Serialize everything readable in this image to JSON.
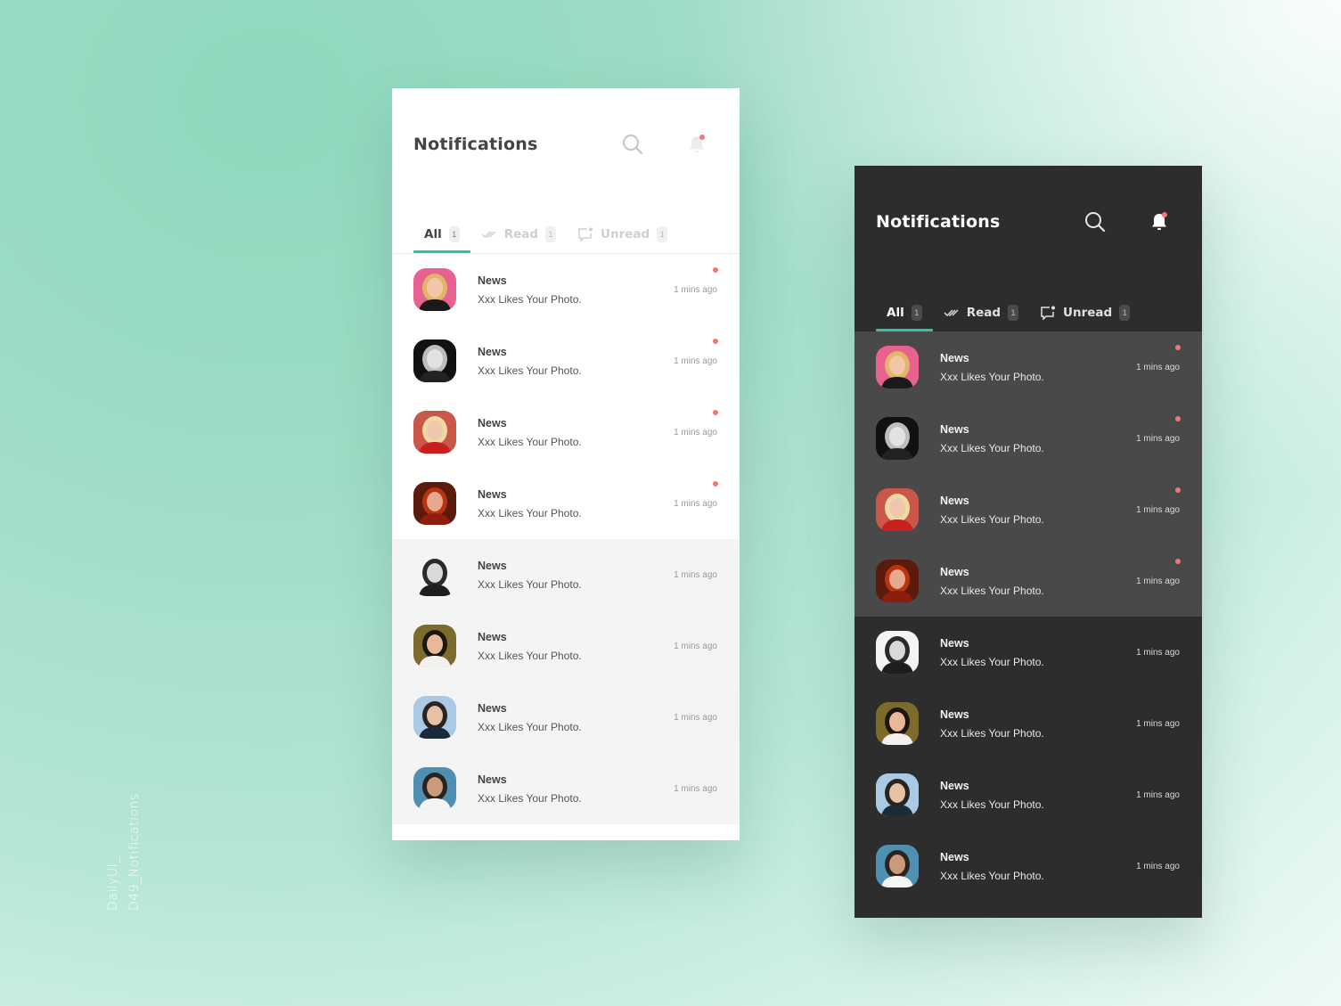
{
  "accent_color": "#2ec1ac",
  "unread_dot_color": "#f47576",
  "caption": {
    "line1": "DailyUI_",
    "line2": "D49_Notifications"
  },
  "panels": [
    {
      "theme": "light",
      "header": {
        "title": "Notifications",
        "search_icon": "search-icon",
        "bell_icon": "bell-icon",
        "bell_has_dot": true
      },
      "tabs": [
        {
          "label": "All",
          "count": "1",
          "icon": "",
          "active": true
        },
        {
          "label": "Read",
          "count": "1",
          "icon": "double-check-icon",
          "active": false
        },
        {
          "label": "Unread",
          "count": "1",
          "icon": "chat-dot-icon",
          "active": false
        }
      ],
      "notifications": [
        {
          "title": "News",
          "message": "Xxx Likes Your Photo.",
          "time": "1 mins ago",
          "unread": true,
          "avatar": "woman-blonde-pink-bg"
        },
        {
          "title": "News",
          "message": "Xxx Likes Your Photo.",
          "time": "1 mins ago",
          "unread": true,
          "avatar": "woman-bw"
        },
        {
          "title": "News",
          "message": "Xxx Likes Your Photo.",
          "time": "1 mins ago",
          "unread": true,
          "avatar": "woman-blonde-red"
        },
        {
          "title": "News",
          "message": "Xxx Likes Your Photo.",
          "time": "1 mins ago",
          "unread": true,
          "avatar": "woman-redhead"
        },
        {
          "title": "News",
          "message": "Xxx Likes Your Photo.",
          "time": "1 mins ago",
          "unread": false,
          "avatar": "man-bw"
        },
        {
          "title": "News",
          "message": "Xxx Likes Your Photo.",
          "time": "1 mins ago",
          "unread": false,
          "avatar": "woman-bangs-outdoor"
        },
        {
          "title": "News",
          "message": "Xxx Likes Your Photo.",
          "time": "1 mins ago",
          "unread": false,
          "avatar": "man-beach-sky"
        },
        {
          "title": "News",
          "message": "Xxx Likes Your Photo.",
          "time": "1 mins ago",
          "unread": false,
          "avatar": "man-sunglasses-sea"
        }
      ]
    },
    {
      "theme": "dark",
      "header": {
        "title": "Notifications",
        "search_icon": "search-icon",
        "bell_icon": "bell-icon",
        "bell_has_dot": true
      },
      "tabs": [
        {
          "label": "All",
          "count": "1",
          "icon": "",
          "active": true
        },
        {
          "label": "Read",
          "count": "1",
          "icon": "double-check-icon",
          "active": false
        },
        {
          "label": "Unread",
          "count": "1",
          "icon": "chat-dot-icon",
          "active": false
        }
      ],
      "notifications": [
        {
          "title": "News",
          "message": "Xxx Likes Your Photo.",
          "time": "1 mins ago",
          "unread": true,
          "avatar": "woman-blonde-pink-bg"
        },
        {
          "title": "News",
          "message": "Xxx Likes Your Photo.",
          "time": "1 mins ago",
          "unread": true,
          "avatar": "woman-bw"
        },
        {
          "title": "News",
          "message": "Xxx Likes Your Photo.",
          "time": "1 mins ago",
          "unread": true,
          "avatar": "woman-blonde-red"
        },
        {
          "title": "News",
          "message": "Xxx Likes Your Photo.",
          "time": "1 mins ago",
          "unread": true,
          "avatar": "woman-redhead"
        },
        {
          "title": "News",
          "message": "Xxx Likes Your Photo.",
          "time": "1 mins ago",
          "unread": false,
          "avatar": "man-bw"
        },
        {
          "title": "News",
          "message": "Xxx Likes Your Photo.",
          "time": "1 mins ago",
          "unread": false,
          "avatar": "woman-bangs-outdoor"
        },
        {
          "title": "News",
          "message": "Xxx Likes Your Photo.",
          "time": "1 mins ago",
          "unread": false,
          "avatar": "man-beach-sky"
        },
        {
          "title": "News",
          "message": "Xxx Likes Your Photo.",
          "time": "1 mins ago",
          "unread": false,
          "avatar": "man-sunglasses-sea"
        }
      ]
    }
  ]
}
